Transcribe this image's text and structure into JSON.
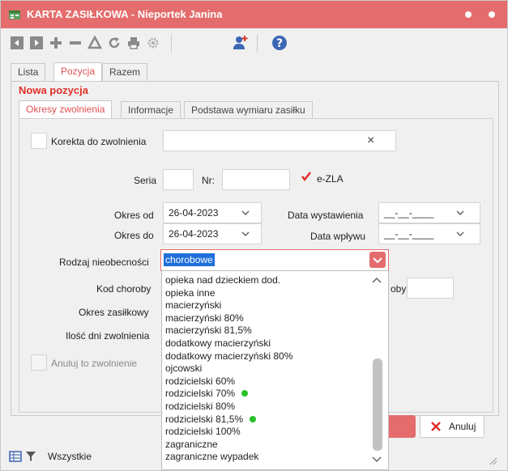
{
  "window": {
    "title": "KARTA ZASIŁKOWA - Nieportek Janina"
  },
  "colors": {
    "accent": "#e46c6c",
    "accent_text": "#e0302a",
    "green_dot": "#27c227"
  },
  "toolbar": {
    "icons": [
      "first-icon",
      "next-icon",
      "plus-icon",
      "minus-icon",
      "triangle-icon",
      "refresh-icon",
      "print-icon",
      "settings-icon",
      "add-user-icon",
      "help-icon"
    ]
  },
  "tabs": {
    "lista": "Lista",
    "pozycja": "Pozycja",
    "razem": "Razem"
  },
  "panel": {
    "title": "Nowa pozycja"
  },
  "subtabs": {
    "okresy": "Okresy zwolnienia",
    "informacje": "Informacje",
    "podstawa": "Podstawa wymiaru zasiłku"
  },
  "form": {
    "korekta_label": "Korekta do zwolnienia",
    "korekta_clear": "×",
    "seria_label": "Seria",
    "nr_label": "Nr:",
    "ezla_label": "e-ZLA",
    "okres_od_label": "Okres od",
    "okres_od_value": "26-04-2023",
    "okres_do_label": "Okres do",
    "okres_do_value": "26-04-2023",
    "data_wystawienia_label": "Data wystawienia",
    "data_wystawienia_value": "__-__-____",
    "data_wplywu_label": "Data wpływu",
    "data_wplywu_value": "__-__-____",
    "rodzaj_label": "Rodzaj nieobecności",
    "rodzaj_value": "chorobowe",
    "kod_choroby_label": "Kod choroby",
    "oby_label": "oby",
    "okres_zasilkowy_label": "Okres zasiłkowy",
    "ilosc_dni_label": "Ilość dni zwolnienia",
    "anuluj_label": "Anuluj to zwolnienie"
  },
  "dropdown": {
    "items": [
      {
        "label": "opieka nad dzieckiem dod.",
        "dot": false
      },
      {
        "label": "opieka inne",
        "dot": false
      },
      {
        "label": "macierzyński",
        "dot": false
      },
      {
        "label": "macierzyński 80%",
        "dot": false
      },
      {
        "label": "macierzyński 81,5%",
        "dot": false
      },
      {
        "label": "dodatkowy macierzyński",
        "dot": false
      },
      {
        "label": "dodatkowy macierzyński 80%",
        "dot": false
      },
      {
        "label": "ojcowski",
        "dot": false
      },
      {
        "label": "rodzicielski 60%",
        "dot": false
      },
      {
        "label": "rodzicielski 70%",
        "dot": true
      },
      {
        "label": "rodzicielski 80%",
        "dot": false
      },
      {
        "label": "rodzicielski 81,5%",
        "dot": true
      },
      {
        "label": "rodzicielski 100%",
        "dot": false
      },
      {
        "label": "zagraniczne",
        "dot": false
      },
      {
        "label": "zagraniczne wypadek",
        "dot": false
      }
    ]
  },
  "buttons": {
    "anuluj": "Anuluj"
  },
  "status": {
    "filter_label": "Wszystkie"
  }
}
